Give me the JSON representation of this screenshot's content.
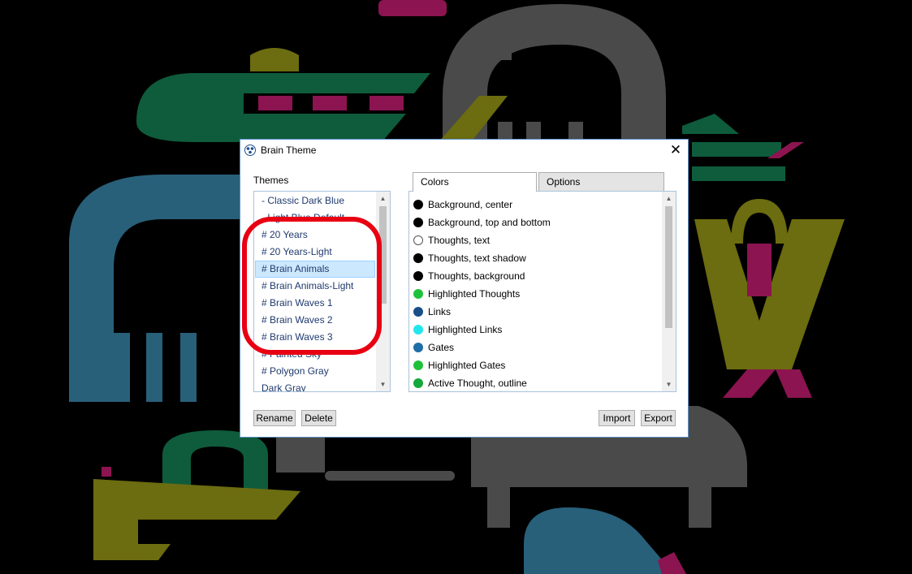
{
  "window": {
    "title": "Brain Theme",
    "close_label": "✕"
  },
  "themes": {
    "label": "Themes",
    "items": [
      "- Classic Dark Blue",
      "- Light Blue Default",
      "# 20 Years",
      "# 20 Years-Light",
      "# Brain Animals",
      "# Brain Animals-Light",
      "# Brain Waves 1",
      "# Brain Waves 2",
      "# Brain Waves 3",
      "# Painted Sky",
      "# Polygon Gray",
      "Dark Gray"
    ],
    "selected": "# Brain Animals"
  },
  "tabs": {
    "colors": "Colors",
    "options": "Options",
    "active": "Colors"
  },
  "colors": [
    {
      "label": "Background, center",
      "color": "#000000"
    },
    {
      "label": "Background, top and bottom",
      "color": "#000000"
    },
    {
      "label": "Thoughts, text",
      "color": "#ffffff"
    },
    {
      "label": "Thoughts, text shadow",
      "color": "#000000"
    },
    {
      "label": "Thoughts, background",
      "color": "#000000"
    },
    {
      "label": "Highlighted Thoughts",
      "color": "#1ec23a"
    },
    {
      "label": "Links",
      "color": "#1a4e86"
    },
    {
      "label": "Highlighted Links",
      "color": "#22e6ee"
    },
    {
      "label": "Gates",
      "color": "#1f6ea8"
    },
    {
      "label": "Highlighted Gates",
      "color": "#1ec23a"
    },
    {
      "label": "Active Thought, outline",
      "color": "#15a83a"
    }
  ],
  "buttons": {
    "rename": "Rename",
    "delete": "Delete",
    "import": "Import",
    "export": "Export"
  },
  "accent_colors": {
    "annotation_ring": "#e80012",
    "selection": "#cce8ff",
    "window_border": "#5a8fc8"
  }
}
